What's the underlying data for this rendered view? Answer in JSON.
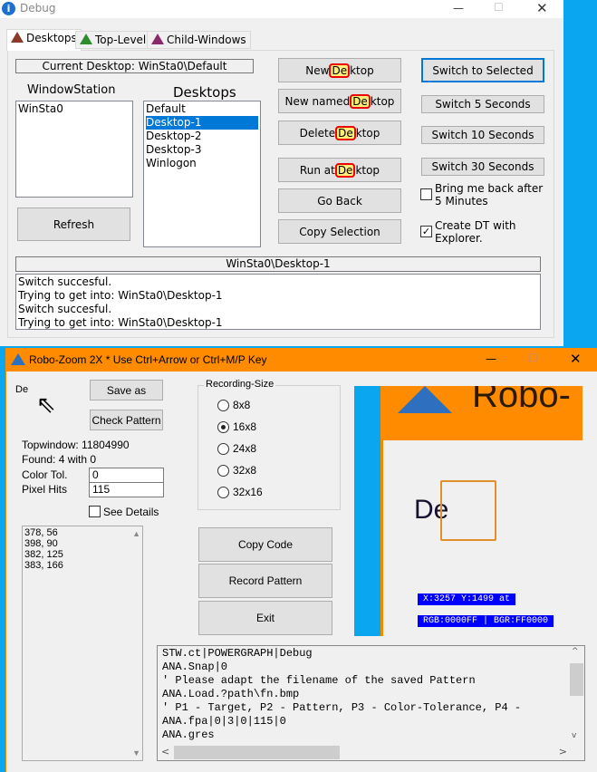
{
  "debug_window": {
    "title": "Debug",
    "tabs": [
      {
        "label": "Desktops",
        "color": "#8b3a2a"
      },
      {
        "label": "Top-Level",
        "color": "#2e8b2e"
      },
      {
        "label": "Child-Windows",
        "color": "#8b2a6b"
      }
    ],
    "current_desktop": "Current Desktop: WinSta0\\Default",
    "windowstation_label": "WindowStation",
    "windowstations": [
      "WinSta0"
    ],
    "desktops_label": "Desktops",
    "desktops": [
      "Default",
      "Desktop-1",
      "Desktop-2",
      "Desktop-3",
      "Winlogon"
    ],
    "selected_desktop": "Desktop-1",
    "refresh": "Refresh",
    "buttons": [
      {
        "pre": "New ",
        "hl": "De",
        "post": "ktop"
      },
      {
        "pre": "New named ",
        "hl": "De",
        "post": "ktop"
      },
      {
        "pre": "Delete ",
        "hl": "De",
        "post": "ktop"
      },
      {
        "pre": "Run at ",
        "hl": "De",
        "post": "ktop"
      }
    ],
    "go_back": "Go Back",
    "copy_selection": "Copy Selection",
    "switch_selected": "Switch to Selected",
    "switch_5": "Switch 5 Seconds",
    "switch_10": "Switch 10 Seconds",
    "switch_30": "Switch 30 Seconds",
    "bring_back": "Bring me back after 5 Minutes",
    "bring_back_checked": false,
    "create_dt": "Create DT with Explorer.",
    "create_dt_checked": true,
    "path": "WinSta0\\Desktop-1",
    "log": [
      "Switch succesful.",
      "Trying to get into: WinSta0\\Desktop-1",
      "Switch succesful.",
      "Trying to get into: WinSta0\\Desktop-1"
    ]
  },
  "robo_window": {
    "title": "Robo-Zoom 2X * Use Ctrl+Arrow or Ctrl+M/P Key",
    "preview_text": "De",
    "save_as": "Save as",
    "check_pattern": "Check Pattern",
    "topwindow": "Topwindow:  11804990",
    "found": "Found:  4 with  0",
    "color_tol_label": "Color Tol.",
    "color_tol": "0",
    "pixel_hits_label": "Pixel Hits",
    "pixel_hits": "115",
    "see_details": "See Details",
    "see_details_checked": false,
    "results": [
      "378, 56",
      "398, 90",
      "382, 125",
      "383, 166"
    ],
    "recording_size_label": "Recording-Size",
    "sizes": [
      "8x8",
      "16x8",
      "24x8",
      "32x8",
      "32x16"
    ],
    "selected_size": "16x8",
    "copy_code": "Copy Code",
    "record_pattern": "Record Pattern",
    "exit": "Exit",
    "zoom_title_fragment": "Robo-",
    "zoom_text": "De",
    "coords": "X:3257 Y:1499 at",
    "rgb": "RGB:0000FF | BGR:FF0000",
    "code": [
      "STW.ct|POWERGRAPH|Debug",
      "ANA.Snap|0",
      "' Please adapt the filename of the saved Pattern",
      "ANA.Load.?path\\fn.bmp",
      "' P1 - Target, P2 - Pattern, P3 - Color-Tolerance, P4 -",
      "ANA.fpa|0|3|0|115|0",
      "ANA.gres"
    ]
  }
}
